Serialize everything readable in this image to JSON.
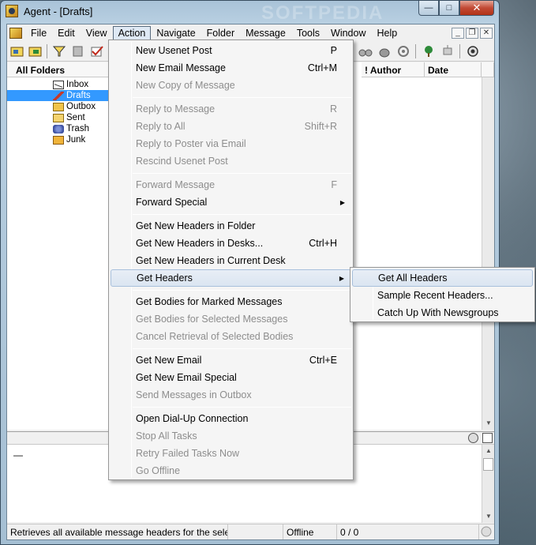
{
  "window": {
    "title": "Agent - [Drafts]",
    "min_glyph": "—",
    "max_glyph": "□",
    "close_glyph": "✕"
  },
  "menubar": {
    "items": [
      "File",
      "Edit",
      "View",
      "Action",
      "Navigate",
      "Folder",
      "Message",
      "Tools",
      "Window",
      "Help"
    ],
    "active": "Action",
    "mdi_buttons": [
      "_",
      "❐",
      "✕"
    ]
  },
  "folders": {
    "header": "All Folders",
    "items": [
      {
        "label": "Inbox",
        "icon": "inbox-icon"
      },
      {
        "label": "Drafts",
        "icon": "drafts-icon",
        "selected": true
      },
      {
        "label": "Outbox",
        "icon": "outbox-icon"
      },
      {
        "label": "Sent",
        "icon": "sent-icon"
      },
      {
        "label": "Trash",
        "icon": "trash-icon"
      },
      {
        "label": "Junk",
        "icon": "junk-icon"
      }
    ]
  },
  "message_list": {
    "columns": [
      "! Author",
      "Date"
    ]
  },
  "action_menu": {
    "items": [
      {
        "label": "New Usenet Post",
        "shortcut": "P",
        "enabled": true
      },
      {
        "label": "New Email Message",
        "shortcut": "Ctrl+M",
        "enabled": true
      },
      {
        "label": "New Copy of Message",
        "shortcut": "",
        "enabled": false
      },
      {
        "label": "Reply to Message",
        "shortcut": "R",
        "enabled": false
      },
      {
        "label": "Reply to All",
        "shortcut": "Shift+R",
        "enabled": false
      },
      {
        "label": "Reply to Poster via Email",
        "shortcut": "",
        "enabled": false
      },
      {
        "label": "Rescind Usenet Post",
        "shortcut": "",
        "enabled": false
      },
      {
        "label": "Forward Message",
        "shortcut": "F",
        "enabled": false
      },
      {
        "label": "Forward Special",
        "shortcut": "",
        "enabled": true,
        "submenu": true
      },
      {
        "label": "Get New Headers in Folder",
        "shortcut": "",
        "enabled": true
      },
      {
        "label": "Get New Headers in Desks...",
        "shortcut": "Ctrl+H",
        "enabled": true
      },
      {
        "label": "Get New Headers in Current Desk",
        "shortcut": "",
        "enabled": true
      },
      {
        "label": "Get Headers",
        "shortcut": "",
        "enabled": true,
        "submenu": true,
        "highlighted": true
      },
      {
        "label": "Get Bodies for Marked Messages",
        "shortcut": "",
        "enabled": true
      },
      {
        "label": "Get Bodies for Selected Messages",
        "shortcut": "",
        "enabled": false
      },
      {
        "label": "Cancel Retrieval of Selected Bodies",
        "shortcut": "",
        "enabled": false
      },
      {
        "label": "Get New Email",
        "shortcut": "Ctrl+E",
        "enabled": true
      },
      {
        "label": "Get New Email Special",
        "shortcut": "",
        "enabled": true
      },
      {
        "label": "Send Messages in Outbox",
        "shortcut": "",
        "enabled": false
      },
      {
        "label": "Open Dial-Up Connection",
        "shortcut": "",
        "enabled": true
      },
      {
        "label": "Stop All Tasks",
        "shortcut": "",
        "enabled": false
      },
      {
        "label": "Retry Failed Tasks Now",
        "shortcut": "",
        "enabled": false
      },
      {
        "label": "Go Offline",
        "shortcut": "",
        "enabled": false
      }
    ]
  },
  "submenu": {
    "items": [
      {
        "label": "Get All Headers",
        "highlighted": true
      },
      {
        "label": "Sample Recent Headers..."
      },
      {
        "label": "Catch Up With Newsgroups"
      }
    ]
  },
  "preview": {
    "text": "—"
  },
  "statusbar": {
    "message": "Retrieves all available message headers for the selected f",
    "connection": "Offline",
    "count": "0 / 0"
  }
}
